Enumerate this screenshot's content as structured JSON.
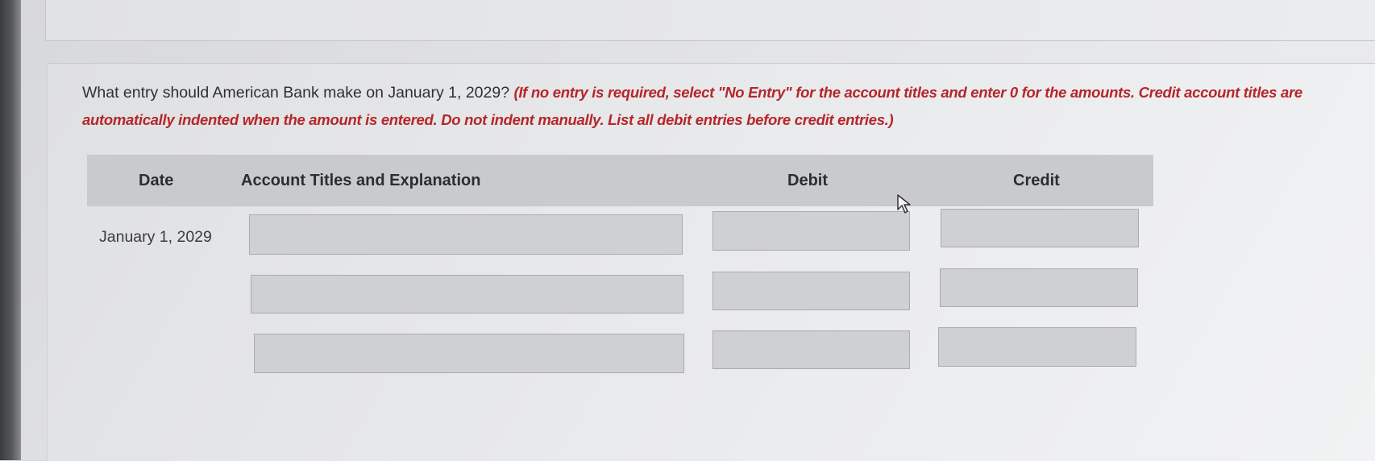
{
  "question": {
    "text": "What entry should American Bank make on January 1, 2029?",
    "instructions": "(If no entry is required, select \"No Entry\" for the account titles and enter 0 for the amounts. Credit account titles are automatically indented when the amount is entered. Do not indent manually. List all debit entries before credit entries.)"
  },
  "table": {
    "headers": {
      "date": "Date",
      "account": "Account Titles and Explanation",
      "debit": "Debit",
      "credit": "Credit"
    },
    "rows": [
      {
        "date": "January 1, 2029",
        "account": "",
        "debit": "",
        "credit": ""
      },
      {
        "date": "",
        "account": "",
        "debit": "",
        "credit": ""
      },
      {
        "date": "",
        "account": "",
        "debit": "",
        "credit": ""
      }
    ]
  },
  "colors": {
    "instruction_text": "#b5262a",
    "header_bar": "#c9cacd",
    "input_fill": "#cfd0d2"
  },
  "icons": [
    "mouse-pointer-icon"
  ]
}
